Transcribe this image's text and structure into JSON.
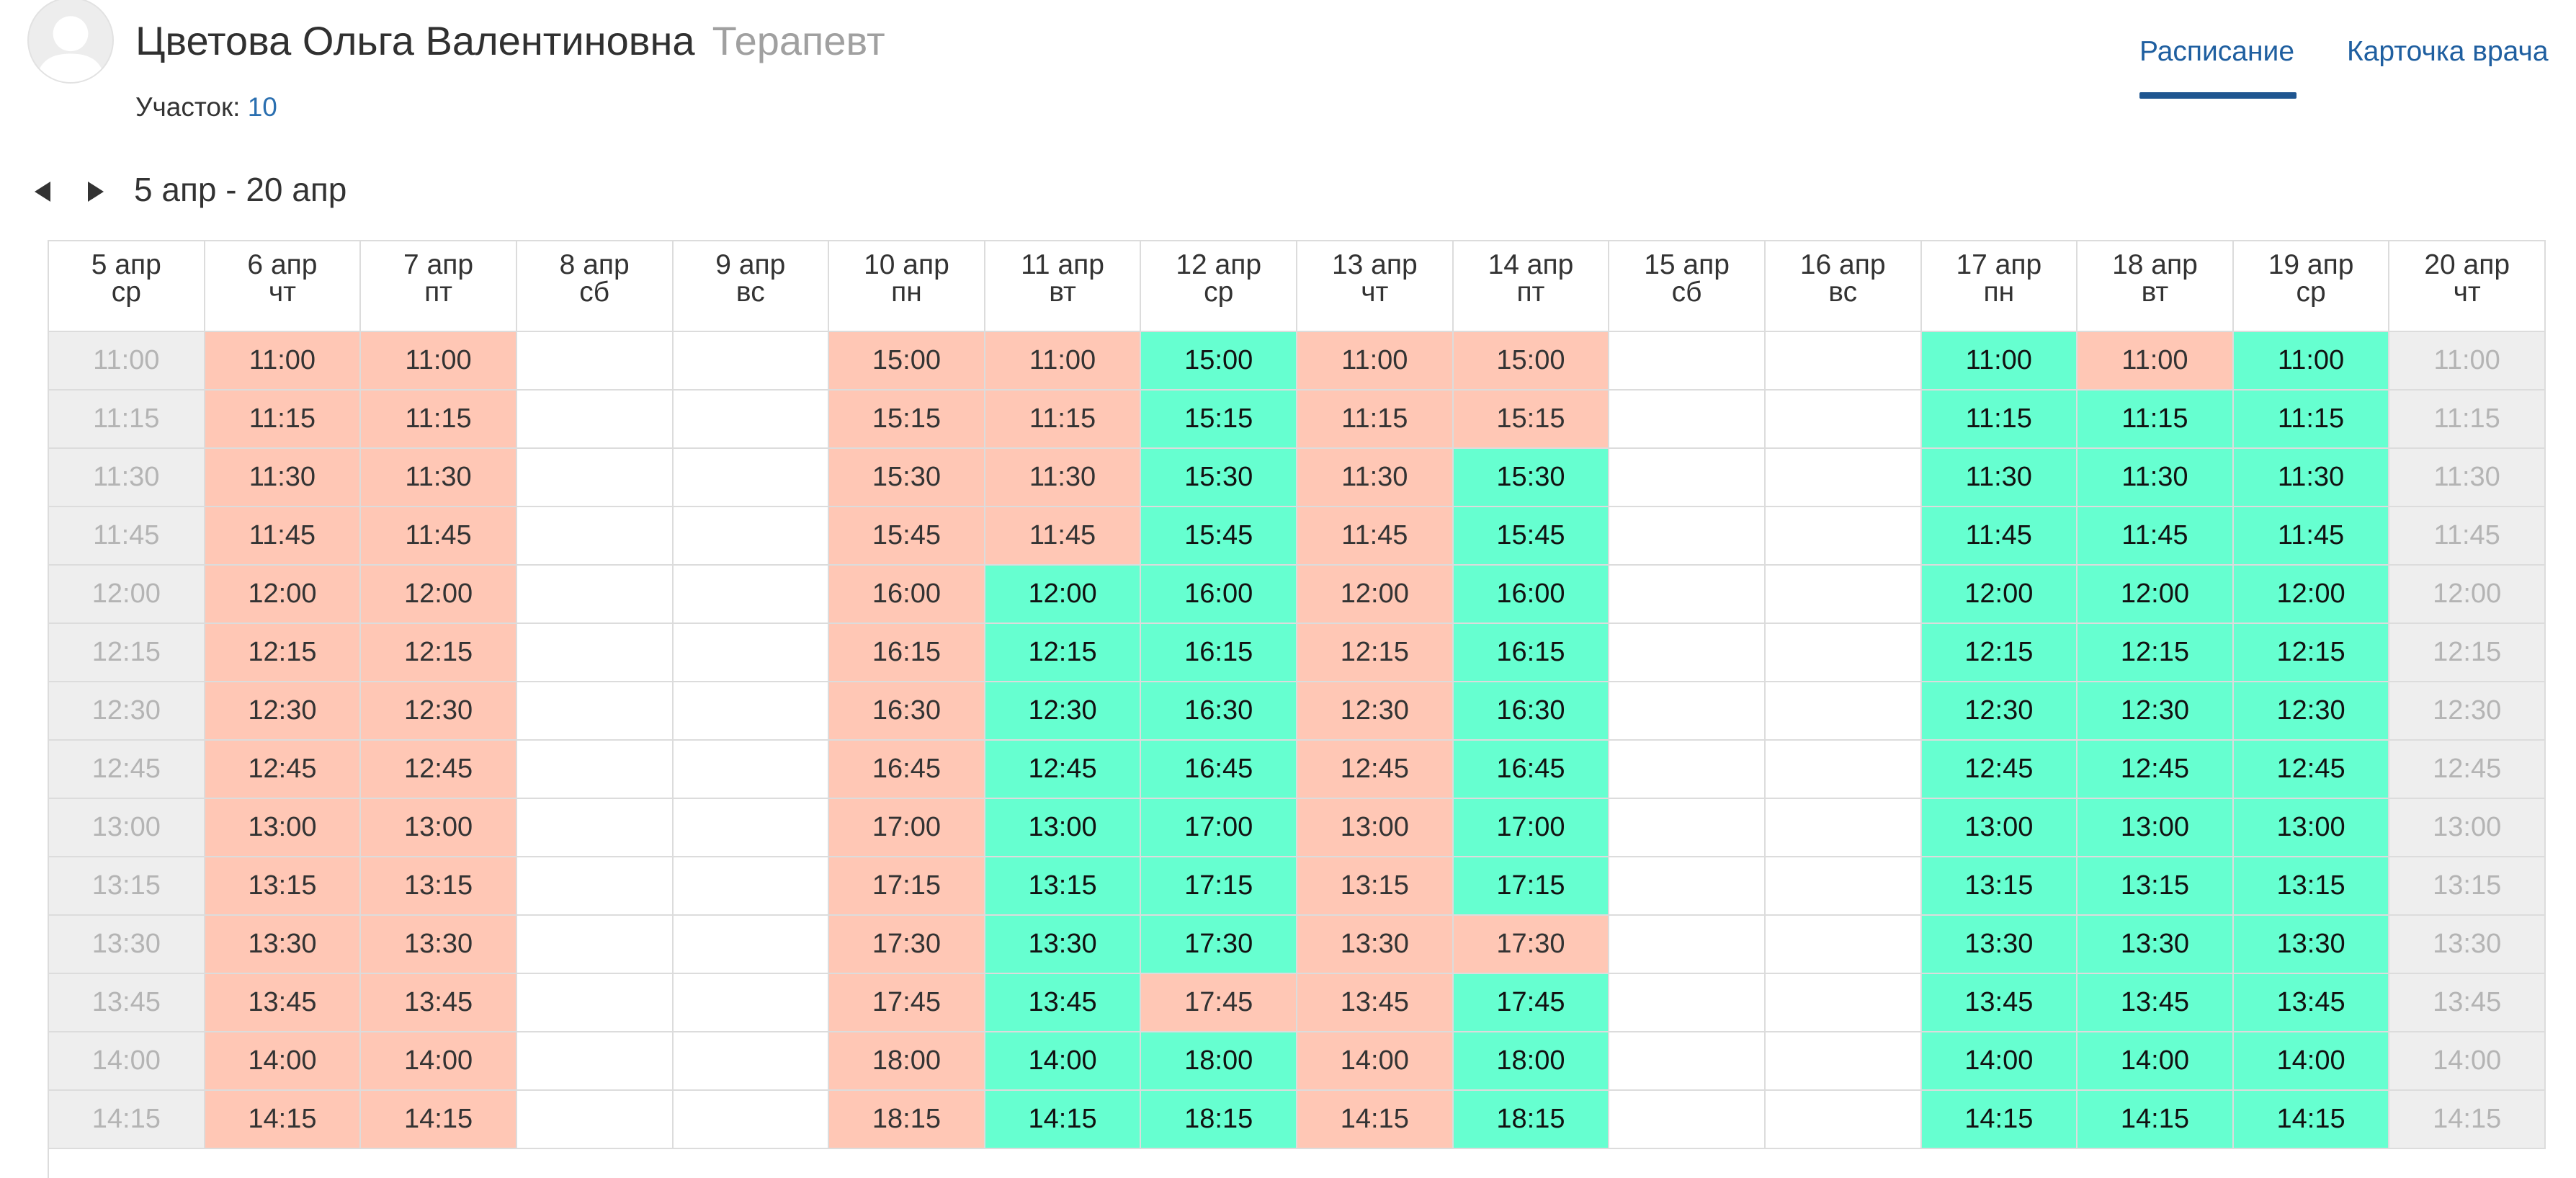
{
  "doctor": {
    "name": "Цветова Ольга Валентиновна",
    "specialty": "Терапевт",
    "district_label": "Участок: ",
    "district_value": "10"
  },
  "nav": {
    "schedule_label": "Расписание",
    "card_label": "Карточка врача",
    "active": "schedule"
  },
  "period": {
    "range_label": "5 апр - 20 апр",
    "prev_icon": "triangle-left-icon",
    "next_icon": "triangle-right-icon"
  },
  "colors": {
    "free": "#66ffd0",
    "busy": "#ffc7b5",
    "unavailable": "#eeeeee",
    "accent": "#1f5fa0"
  },
  "days": [
    {
      "date": "5 апр",
      "dow": "ср",
      "start": "11:00",
      "states": "oooooooooooooo"
    },
    {
      "date": "6 апр",
      "dow": "чт",
      "start": "11:00",
      "states": "bbbbbbbbbbbbbb"
    },
    {
      "date": "7 апр",
      "dow": "пт",
      "start": "11:00",
      "states": "bbbbbbbbbbbbbb"
    },
    {
      "date": "8 апр",
      "dow": "сб",
      "start": "",
      "states": ""
    },
    {
      "date": "9 апр",
      "dow": "вс",
      "start": "",
      "states": ""
    },
    {
      "date": "10 апр",
      "dow": "пн",
      "start": "15:00",
      "states": "bbbbbbbbbbbbbb"
    },
    {
      "date": "11 апр",
      "dow": "вт",
      "start": "11:00",
      "states": "bbbbffffffffff"
    },
    {
      "date": "12 апр",
      "dow": "ср",
      "start": "15:00",
      "states": "fffffffffffbff"
    },
    {
      "date": "13 апр",
      "dow": "чт",
      "start": "11:00",
      "states": "bbbbbbbbbbbbbb"
    },
    {
      "date": "14 апр",
      "dow": "пт",
      "start": "15:00",
      "states": "bbffffffffbfff"
    },
    {
      "date": "15 апр",
      "dow": "сб",
      "start": "",
      "states": ""
    },
    {
      "date": "16 апр",
      "dow": "вс",
      "start": "",
      "states": ""
    },
    {
      "date": "17 апр",
      "dow": "пн",
      "start": "11:00",
      "states": "ffffffffffffff"
    },
    {
      "date": "18 апр",
      "dow": "вт",
      "start": "11:00",
      "states": "bfffffffffffff"
    },
    {
      "date": "19 апр",
      "dow": "ср",
      "start": "11:00",
      "states": "ffffffffffffff"
    },
    {
      "date": "20 апр",
      "dow": "чт",
      "start": "11:00",
      "states": "oooooooooooooo"
    }
  ]
}
